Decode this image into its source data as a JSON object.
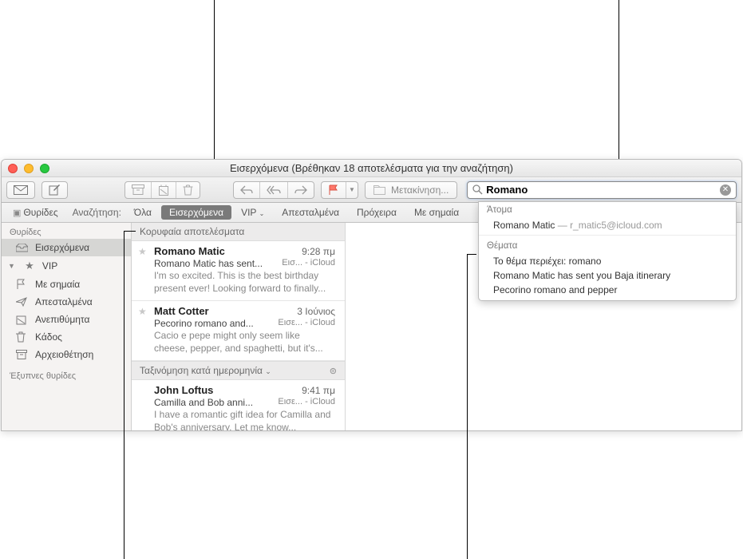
{
  "window": {
    "title": "Εισερχόμενα (Βρέθηκαν 18 αποτελέσματα για την αναζήτηση)"
  },
  "toolbar": {
    "move_label": "Μετακίνηση..."
  },
  "search": {
    "value": "Romano"
  },
  "favbar": {
    "mailboxes": "Θυρίδες",
    "search_label": "Αναζήτηση:",
    "scopes": [
      {
        "label": "Όλα",
        "selected": false
      },
      {
        "label": "Εισερχόμενα",
        "selected": true
      },
      {
        "label": "VIP",
        "selected": false,
        "dropdown": true
      },
      {
        "label": "Απεσταλμένα",
        "selected": false
      },
      {
        "label": "Πρόχειρα",
        "selected": false
      },
      {
        "label": "Με σημαία",
        "selected": false
      }
    ]
  },
  "sidebar": {
    "heading1": "Θυρίδες",
    "items": [
      {
        "icon": "inbox",
        "label": "Εισερχόμενα",
        "selected": true
      },
      {
        "icon": "star",
        "label": "VIP",
        "disclosure": true
      },
      {
        "icon": "flag",
        "label": "Με σημαία"
      },
      {
        "icon": "sent",
        "label": "Απεσταλμένα"
      },
      {
        "icon": "junk",
        "label": "Ανεπιθύμητα"
      },
      {
        "icon": "trash",
        "label": "Κάδος"
      },
      {
        "icon": "archive",
        "label": "Αρχειοθέτηση"
      }
    ],
    "heading2": "Έξυπνες θυρίδες"
  },
  "msglist": {
    "header": "Κορυφαία αποτελέσματα",
    "sort_label": "Ταξινόμηση κατά ημερομηνία",
    "messages": [
      {
        "sender": "Romano Matic",
        "time": "9:28 πμ",
        "subject": "Romano Matic has sent...",
        "box": "Εισ... - iCloud",
        "preview": "I'm so excited. This is the best birthday present ever! Looking forward to finally..."
      },
      {
        "sender": "Matt Cotter",
        "time": "3 Ιούνιος",
        "subject": "Pecorino romano and...",
        "box": "Εισε... - iCloud",
        "preview": "Cacio e pepe might only seem like cheese, pepper, and spaghetti, but it's..."
      },
      {
        "sender": "John Loftus",
        "time": "9:41 πμ",
        "subject": "Camilla and Bob anni...",
        "box": "Εισε... - iCloud",
        "preview": "I have a romantic gift idea for Camilla and Bob's anniversary. Let me know..."
      }
    ]
  },
  "suggestions": {
    "people_heading": "Άτομα",
    "person_name": "Romano Matic",
    "person_email": "r_matic5@icloud.com",
    "subjects_heading": "Θέματα",
    "subjects": [
      "Το θέμα περιέχει: romano",
      "Romano Matic has sent you Baja itinerary",
      "Pecorino romano and pepper"
    ]
  }
}
